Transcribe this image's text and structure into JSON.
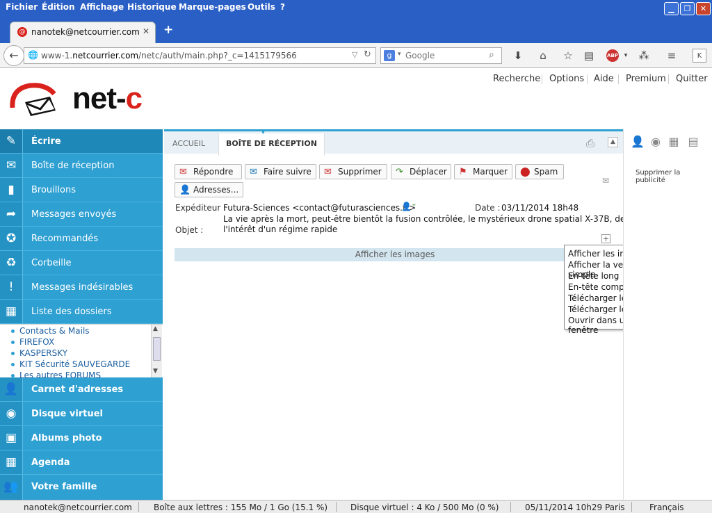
{
  "browser": {
    "menu": [
      "Fichier",
      "Édition",
      "Affichage",
      "Historique",
      "Marque-pages",
      "Outils",
      "?"
    ],
    "tab_title": "nanotek@netcourrier.com",
    "url_host": "www-1.",
    "url_domain": "netcourrier.com",
    "url_path": "/netc/auth/main.php?_c=1415179566",
    "search_placeholder": "Google"
  },
  "header": {
    "logo_net": "net-",
    "logo_c": "c",
    "links": [
      "Recherche",
      "Options",
      "Aide",
      "Premium",
      "Quitter"
    ]
  },
  "sidebar": {
    "compose": "Écrire",
    "items": [
      "Boîte de réception",
      "Brouillons",
      "Messages envoyés",
      "Recommandés",
      "Corbeille",
      "Messages indésirables",
      "Liste des dossiers"
    ],
    "folders": [
      "Contacts & Mails",
      "FIREFOX",
      "KASPERSKY",
      "KIT Sécurité SAUVEGARDE",
      "Les autres FORUMS"
    ],
    "sections": [
      "Carnet d'adresses",
      "Disque virtuel",
      "Albums photo",
      "Agenda",
      "Votre famille"
    ]
  },
  "tabs": [
    "ACCUEIL",
    "BOÎTE DE RÉCEPTION"
  ],
  "actions": [
    "Répondre",
    "Faire suivre",
    "Supprimer",
    "Déplacer",
    "Marquer",
    "Spam",
    "Adresses..."
  ],
  "message": {
    "sender_label": "Expéditeur :",
    "sender": "Futura-Sciences <contact@futurasciences.fr>",
    "date_label": "Date :",
    "date": "03/11/2014 18h48",
    "subject_label": "Objet :",
    "subject_line1": "La vie après la mort, peut-être bientôt la fusion contrôlée, le mystérieux drone spatial X-37B, de",
    "subject_line2": "l'intérêt d'un régime rapide",
    "show_images": "Afficher les images"
  },
  "popup_menu": [
    "Afficher les images",
    "Afficher la version texte simple",
    "En-tête long",
    "En-tête complet",
    "Télécharger le message (.eml)",
    "Télécharger le message (.txt)",
    "Ouvrir dans une nouvelle fenêtre"
  ],
  "right_panel": {
    "ad_remove": "Supprimer la publicité"
  },
  "status": {
    "user": "nanotek@netcourrier.com",
    "mailbox": "Boîte aux lettres : 155 Mo / 1 Go (15.1 %)",
    "disk": "Disque virtuel : 4 Ko / 500 Mo (0 %)",
    "datetime": "05/11/2014 10h29 Paris",
    "language": "Français"
  },
  "colors": {
    "accent": "#2ea0d2",
    "logo_red": "#d9221b"
  }
}
